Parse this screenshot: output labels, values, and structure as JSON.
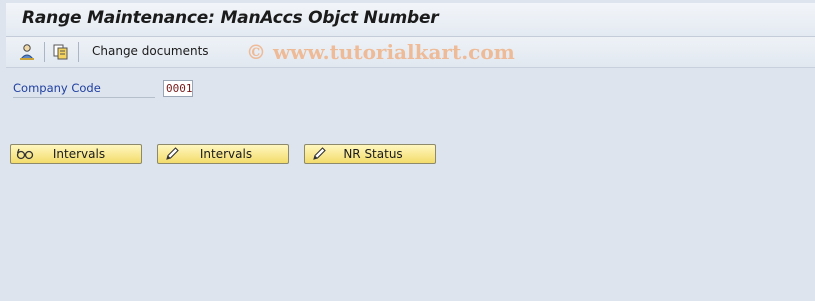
{
  "window": {
    "title": "Range Maintenance: ManAccs Objct Number"
  },
  "toolbar": {
    "items": [
      {
        "icon": "person-icon"
      },
      {
        "icon": "copy-icon"
      }
    ],
    "change_documents_label": "Change documents"
  },
  "watermark": "© www.tutorialkart.com",
  "form": {
    "company_code_label": "Company Code",
    "company_code_value": "0001"
  },
  "buttons": [
    {
      "label": "Intervals",
      "icon": "glasses-display-icon"
    },
    {
      "label": "Intervals",
      "icon": "pencil-edit-icon"
    },
    {
      "label": "NR Status",
      "icon": "pencil-edit-icon"
    }
  ],
  "colors": {
    "background": "#dde4ee",
    "field_label": "#1f3fa0",
    "button_yellow": "#f3dc6b",
    "watermark": "#f0aa78"
  }
}
